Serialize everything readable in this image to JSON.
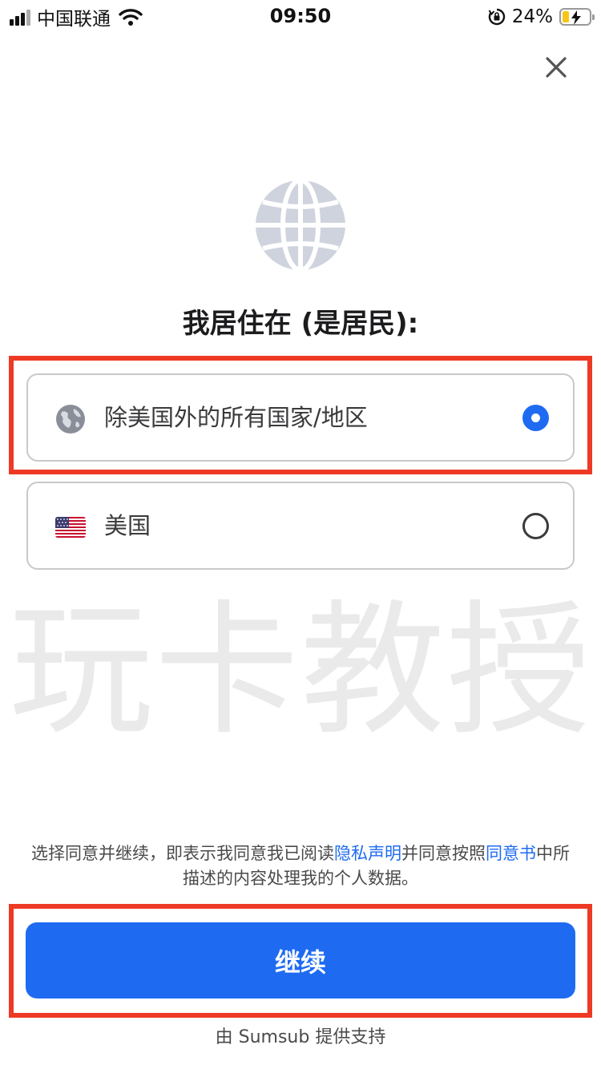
{
  "status_bar": {
    "carrier": "中国联通",
    "time": "09:50",
    "battery_percent": "24%",
    "battery_level": 0.24,
    "icons": [
      "signal-icon",
      "wifi-icon",
      "orientation-lock-icon",
      "battery-charging-icon"
    ]
  },
  "header": {
    "close_icon": "close-icon"
  },
  "main": {
    "hero_icon": "globe-icon",
    "heading": "我居住在 (是居民):",
    "options": [
      {
        "label": "除美国外的所有国家/地区",
        "icon": "globe-icon",
        "selected": true
      },
      {
        "label": "美国",
        "icon": "us-flag-icon",
        "selected": false
      }
    ]
  },
  "watermark": "玩卡教授",
  "consent": {
    "prefix": "选择同意并继续，即表示我同意我已阅读",
    "privacy_link": "隐私声明",
    "middle": "并同意按照",
    "agreement_link": "同意书",
    "suffix": "中所描述的内容处理我的个人数据。"
  },
  "footer": {
    "continue_label": "继续",
    "powered_by": "由 Sumsub 提供支持"
  },
  "colors": {
    "accent": "#1e6bf2",
    "highlight": "#ee3a24",
    "globe": "#cfd3de"
  }
}
